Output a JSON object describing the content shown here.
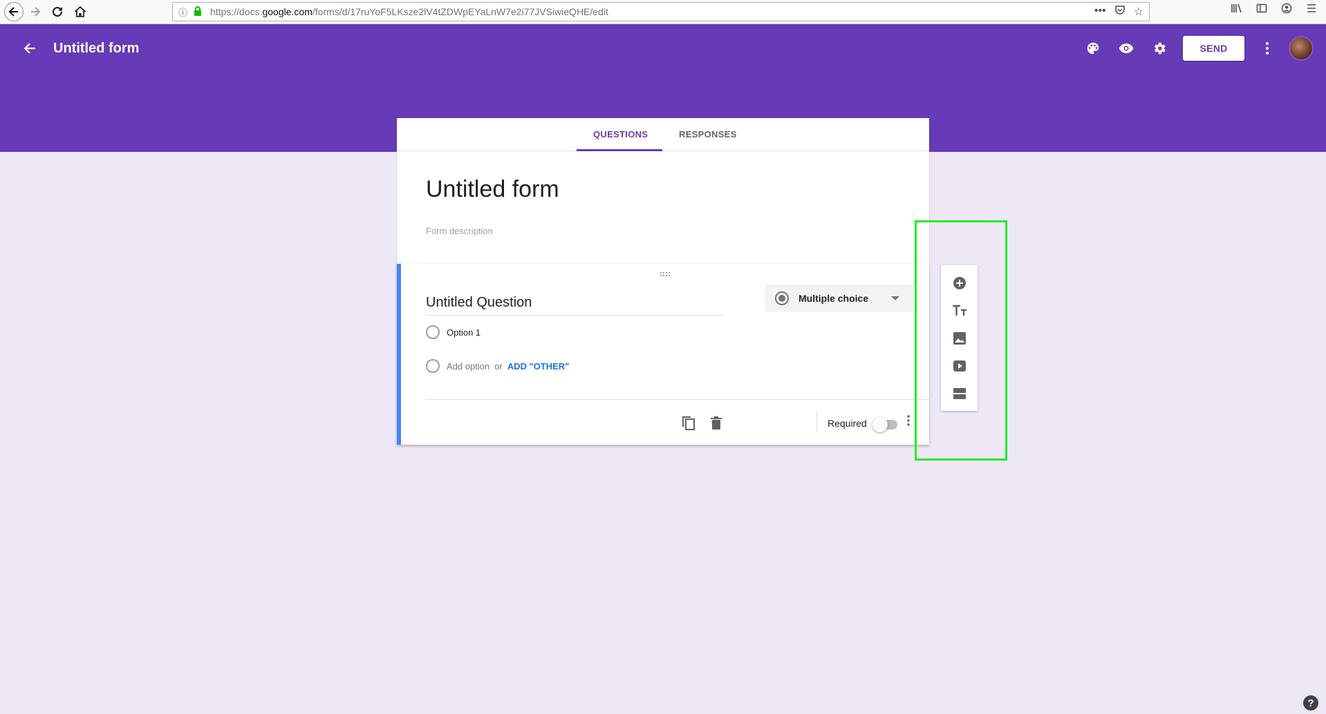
{
  "browser": {
    "url_prefix": "https://docs.",
    "url_domain": "google.com",
    "url_path": "/forms/d/17ruYoF5LKsze2lV4tZDWpEYaLnW7e2i77JVSiwieQHE/edit"
  },
  "header": {
    "title": "Untitled form",
    "send_label": "SEND"
  },
  "tabs": {
    "questions": "QUESTIONS",
    "responses": "RESPONSES",
    "active": "QUESTIONS"
  },
  "form": {
    "title": "Untitled form",
    "description_placeholder": "Form description"
  },
  "question": {
    "title": "Untitled Question",
    "type": "Multiple choice",
    "options": [
      "Option 1"
    ],
    "add_option": "Add option",
    "or_text": "or",
    "add_other": "ADD \"OTHER\"",
    "required_label": "Required",
    "required": false
  },
  "side_toolbar": {
    "icons": [
      "add-question-icon",
      "add-title-icon",
      "add-image-icon",
      "add-video-icon",
      "add-section-icon"
    ]
  },
  "colors": {
    "brand": "#673ab7",
    "background": "#ede7f6",
    "highlight": "#22ee22",
    "accent_blue": "#4285f4"
  }
}
